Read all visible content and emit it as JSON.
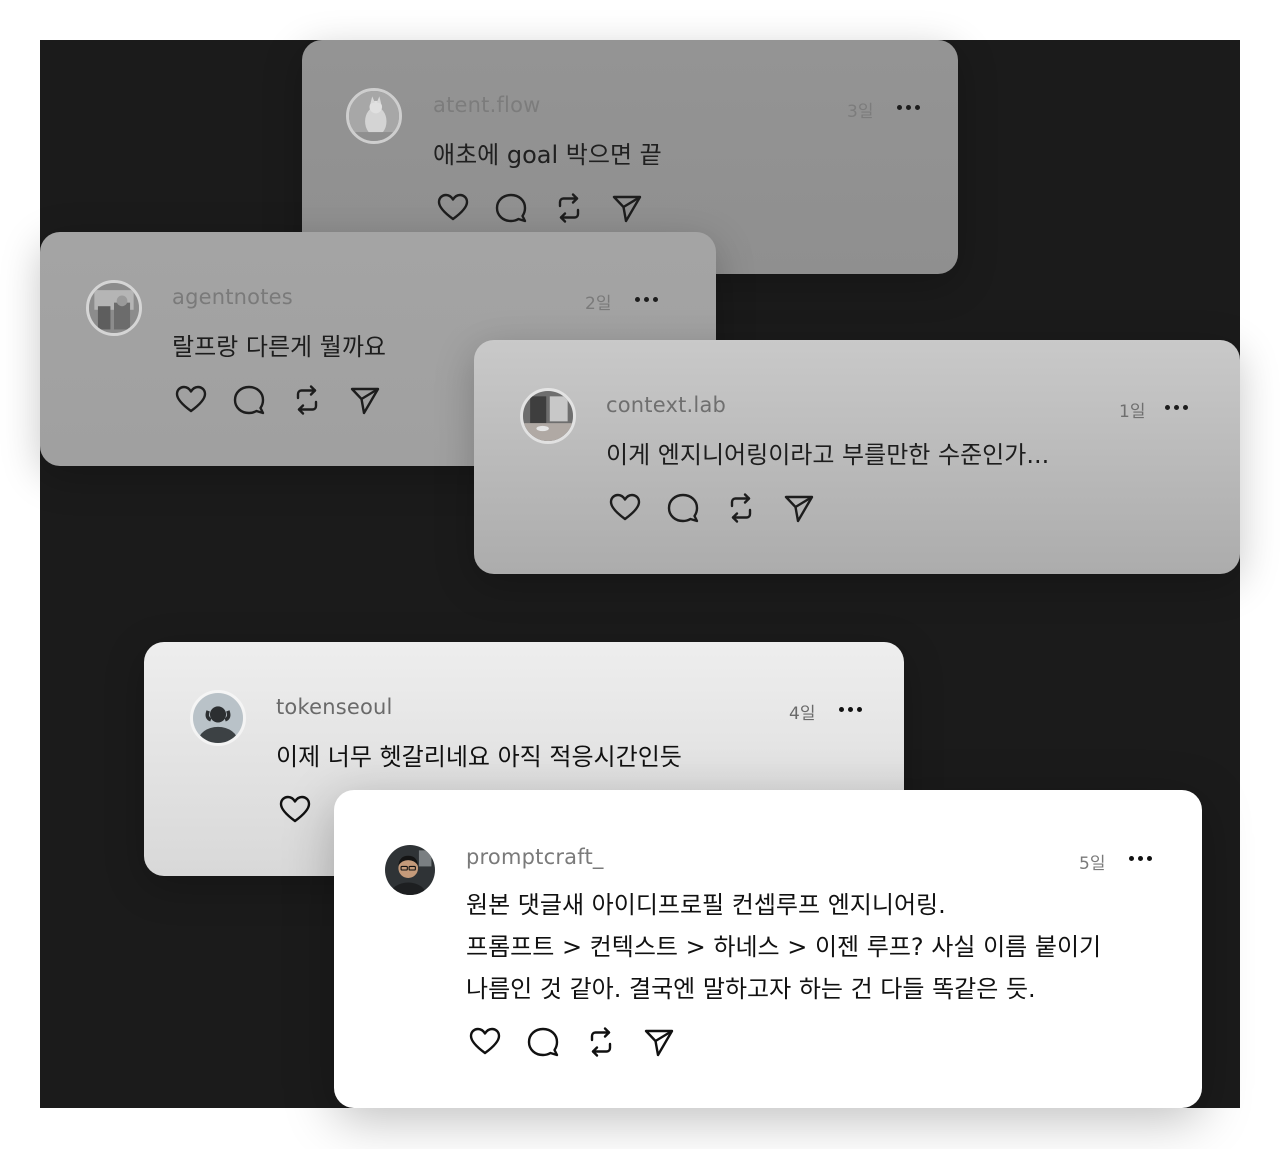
{
  "posts": [
    {
      "username": "atent.flow",
      "time": "3일",
      "text": [
        "애초에 goal 박으면 끝"
      ]
    },
    {
      "username": "agentnotes",
      "time": "2일",
      "text": [
        "랄프랑 다른게 뭘까요"
      ]
    },
    {
      "username": "context.lab",
      "time": "1일",
      "text": [
        "이게 엔지니어링이라고 부를만한 수준인가..."
      ]
    },
    {
      "username": "tokenseoul",
      "time": "4일",
      "text": [
        "이제 너무 헷갈리네요 아직 적응시간인듯"
      ]
    },
    {
      "username": "promptcraft_",
      "time": "5일",
      "text": [
        "원본 댓글새 아이디프로필 컨셉루프 엔지니어링.",
        "프롬프트 > 컨텍스트 > 하네스 > 이젠 루프? 사실 이름 붙이기",
        "나름인 것 같아. 결국엔 말하고자 하는 건 다들 똑같은 듯."
      ]
    }
  ],
  "icons": [
    "heart-icon",
    "comment-icon",
    "repost-icon",
    "share-icon",
    "more-icon"
  ],
  "colors": {
    "backdrop": "#1b1b1b",
    "front_card": "#ffffff"
  }
}
